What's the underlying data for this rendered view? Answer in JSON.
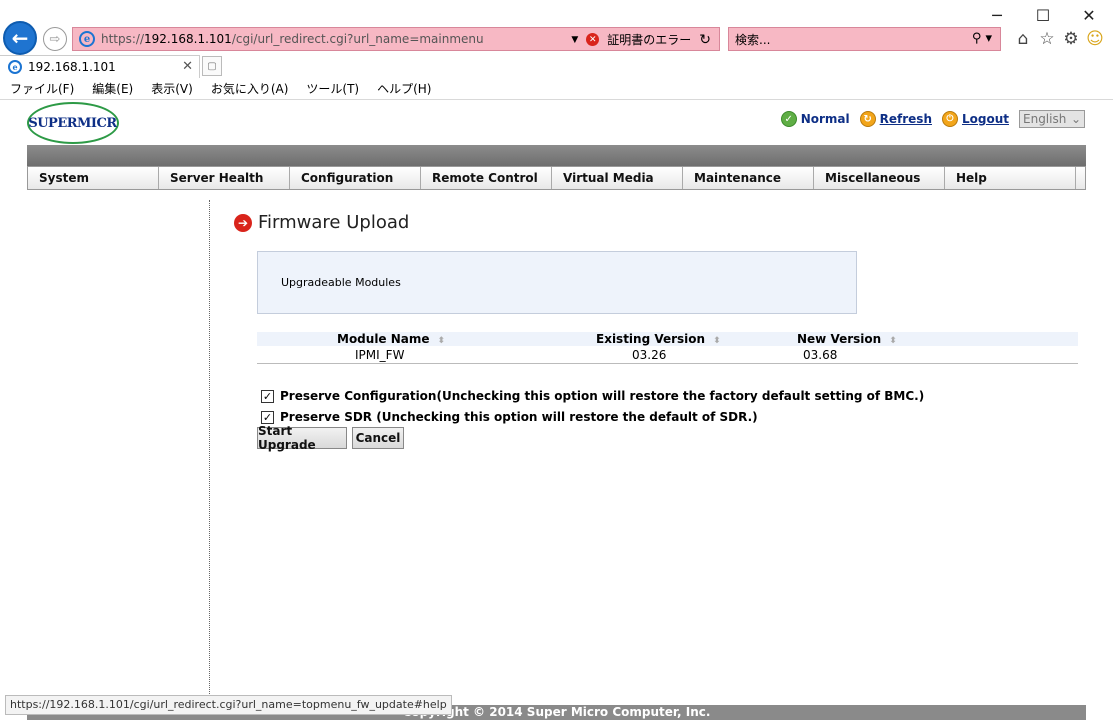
{
  "browser": {
    "window_controls": {
      "minimize": "─",
      "maximize": "☐",
      "close": "✕"
    },
    "back_glyph": "←",
    "forward_glyph": "⇨",
    "address": {
      "proto": "https://",
      "host": "192.168.1.101",
      "rest": "/cgi/url_redirect.cgi?url_name=mainmenu",
      "cert_error": "証明書のエラー"
    },
    "search_placeholder": "検索...",
    "tab_title": "192.168.1.101",
    "menu": [
      "ファイル(F)",
      "編集(E)",
      "表示(V)",
      "お気に入り(A)",
      "ツール(T)",
      "ヘルプ(H)"
    ],
    "status_url": "https://192.168.1.101/cgi/url_redirect.cgi?url_name=topmenu_fw_update#help"
  },
  "header": {
    "logo_text": "SUPERMICR",
    "status_label": "Normal",
    "refresh_label": "Refresh",
    "logout_label": "Logout",
    "language": "English"
  },
  "nav": [
    "System",
    "Server Health",
    "Configuration",
    "Remote Control",
    "Virtual Media",
    "Maintenance",
    "Miscellaneous",
    "Help"
  ],
  "main": {
    "title": "Firmware Upload",
    "modules_box_label": "Upgradeable Modules",
    "table": {
      "headers": [
        "Module Name",
        "Existing Version",
        "New Version"
      ],
      "rows": [
        [
          "IPMI_FW",
          "03.26",
          "03.68"
        ]
      ]
    },
    "options": [
      {
        "label": "Preserve Configuration(Unchecking this option will restore the factory default setting of BMC.)",
        "checked": true
      },
      {
        "label": "Preserve SDR (Unchecking this option will restore the default of SDR.)",
        "checked": true
      }
    ],
    "start_upgrade_label": "Start Upgrade",
    "cancel_label": "Cancel"
  },
  "footer": {
    "copyright": "Copyright © 2014 Super Micro Computer, Inc."
  }
}
